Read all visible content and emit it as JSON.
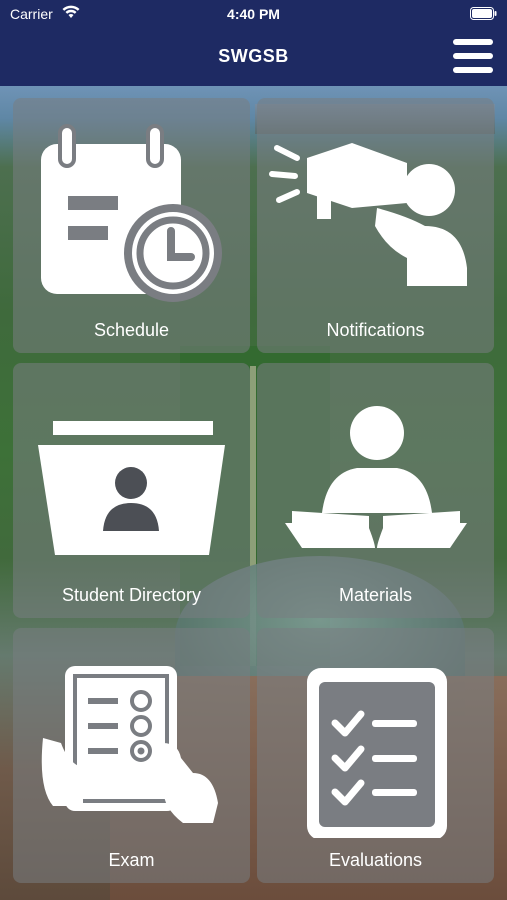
{
  "status": {
    "carrier": "Carrier",
    "time": "4:40 PM"
  },
  "header": {
    "title": "SWGSB",
    "menu_icon": "hamburger-menu-icon"
  },
  "tiles": [
    {
      "label": "Schedule",
      "icon": "calendar-clock-icon"
    },
    {
      "label": "Notifications",
      "icon": "megaphone-person-icon"
    },
    {
      "label": "Student Directory",
      "icon": "card-file-person-icon"
    },
    {
      "label": "Materials",
      "icon": "person-reading-book-icon"
    },
    {
      "label": "Exam",
      "icon": "tablet-test-icon"
    },
    {
      "label": "Evaluations",
      "icon": "checklist-icon"
    }
  ],
  "colors": {
    "header_bg": "#1e2a63",
    "tile_bg": "rgba(120,125,130,0.55)",
    "text": "#ffffff"
  }
}
